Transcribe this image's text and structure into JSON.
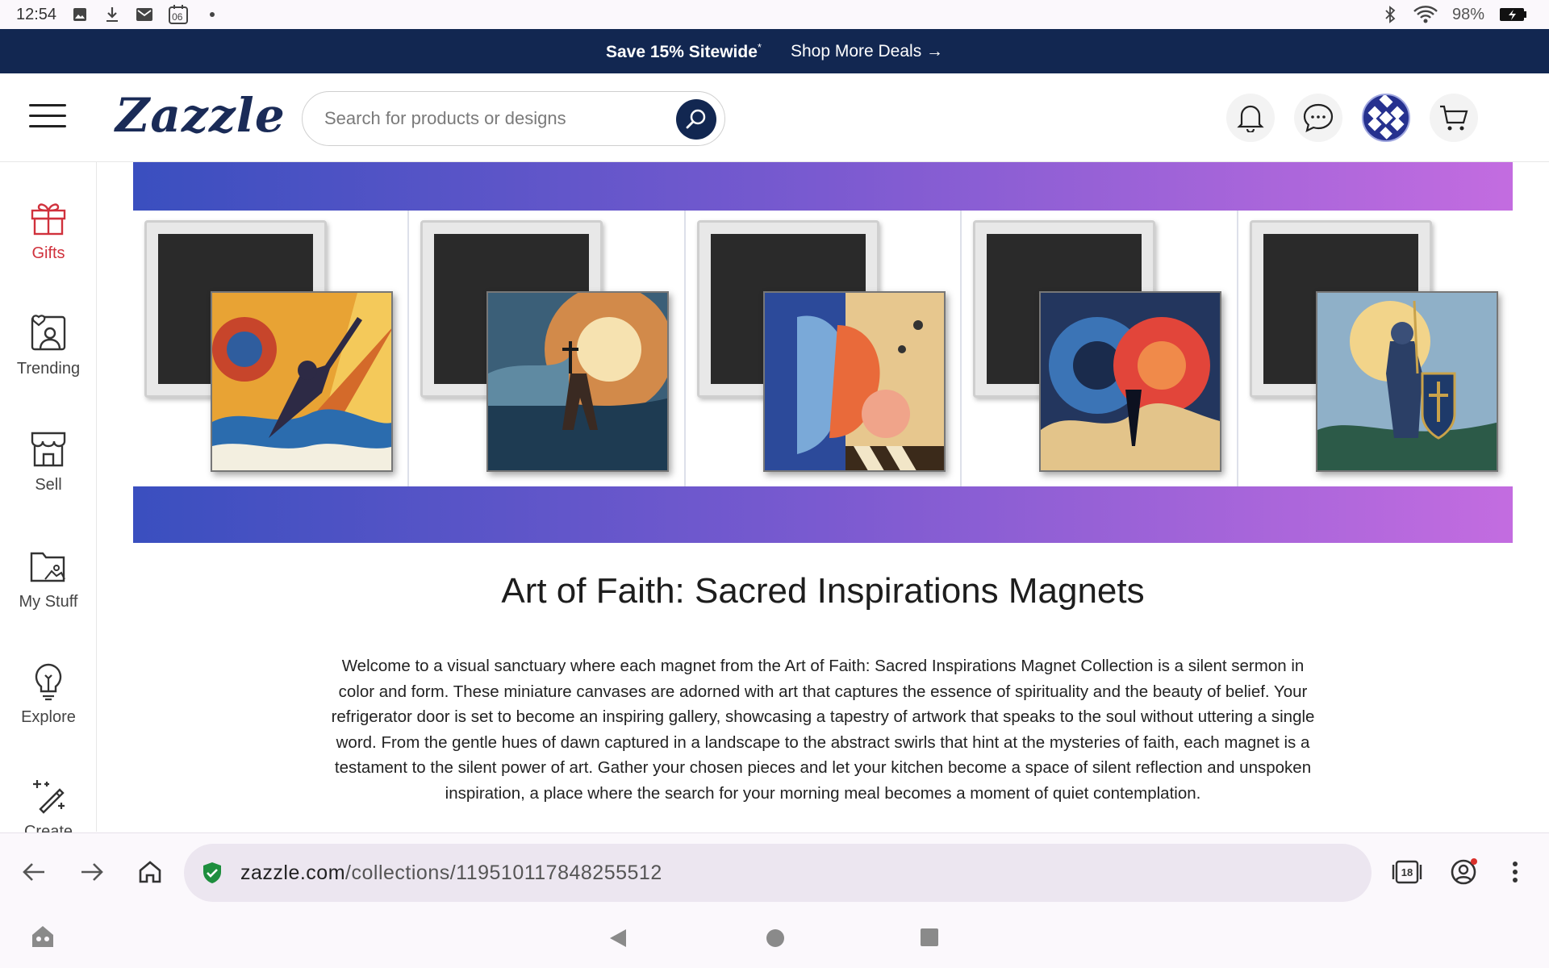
{
  "status_bar": {
    "time": "12:54",
    "calendar_day": "06",
    "battery": "98%"
  },
  "promo": {
    "offer": "Save 15% Sitewide",
    "offer_mark": "*",
    "deals_link": "Shop More Deals →"
  },
  "header": {
    "logo": "Zazzle",
    "search_placeholder": "Search for products or designs"
  },
  "sidebar": {
    "items": [
      {
        "label": "Gifts",
        "icon": "gift-icon"
      },
      {
        "label": "Trending",
        "icon": "trending-icon"
      },
      {
        "label": "Sell",
        "icon": "store-icon"
      },
      {
        "label": "My Stuff",
        "icon": "folder-icon"
      },
      {
        "label": "Explore",
        "icon": "lightbulb-icon"
      },
      {
        "label": "Create",
        "icon": "magic-wand-icon"
      }
    ]
  },
  "collection": {
    "title": "Art of Faith: Sacred Inspirations Magnets",
    "description": "Welcome to a visual sanctuary where each magnet from the Art of Faith: Sacred Inspirations Magnet Collection is a silent sermon in color and form. These miniature canvases are adorned with art that captures the essence of spirituality and the beauty of belief. Your refrigerator door is set to become an inspiring gallery, showcasing a tapestry of artwork that speaks to the soul without uttering a single word. From the gentle hues of dawn captured in a landscape to the abstract swirls that hint at the mysteries of faith, each magnet is a testament to the silent power of art. Gather your chosen pieces and let your kitchen become a space of silent reflection and unspoken inspiration, a place where the search for your morning meal becomes a moment of quiet contemplation."
  },
  "browser": {
    "url_domain": "zazzle.com",
    "url_path": "/collections/119510117848255512",
    "tab_count": "18"
  },
  "colors": {
    "navy": "#122751",
    "gifts_red": "#d0313c",
    "banner_start": "#3a4fbf",
    "banner_end": "#c36ce0"
  }
}
